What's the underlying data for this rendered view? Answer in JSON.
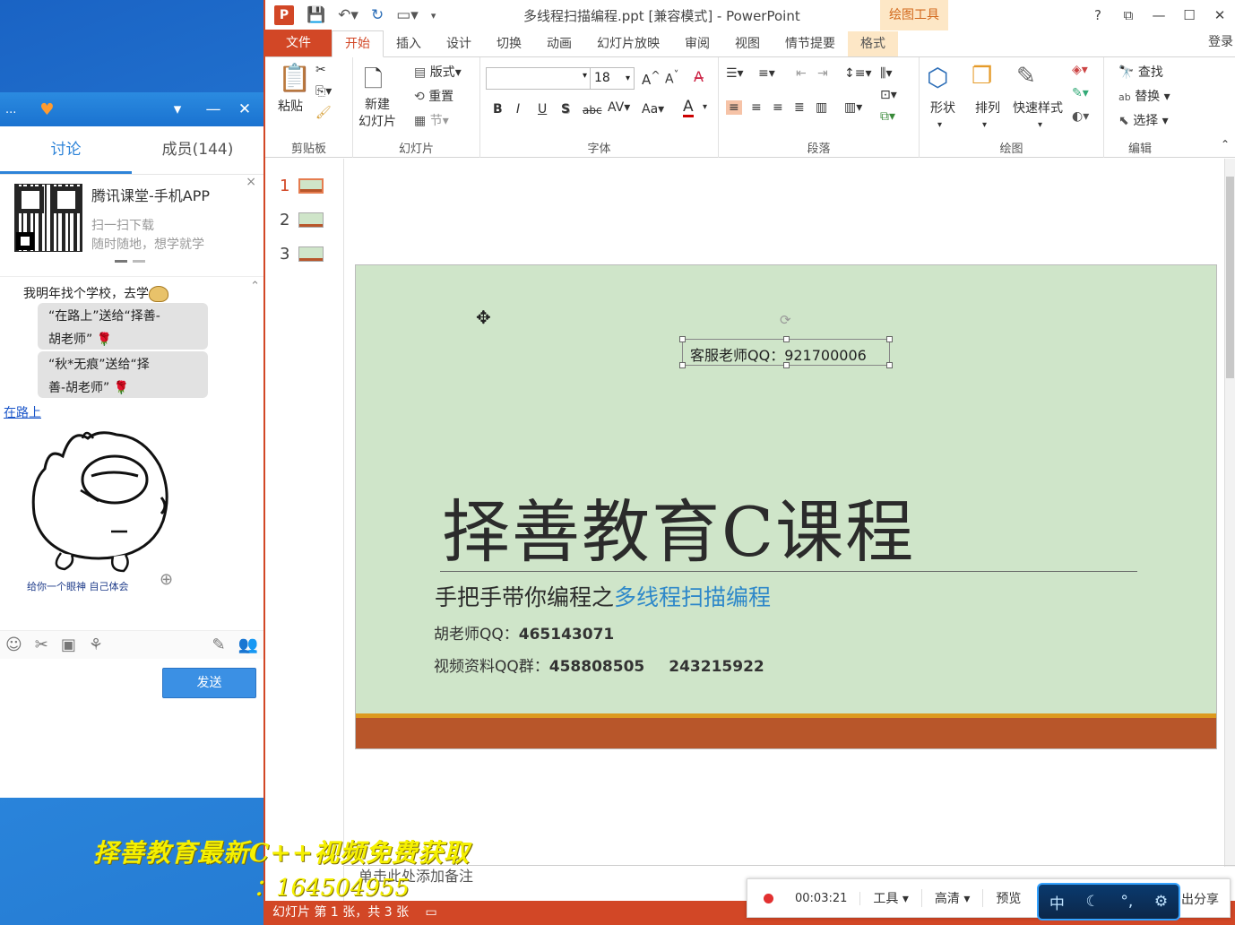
{
  "chat": {
    "title_menu": "...",
    "tabs": [
      "讨论",
      "成员(144)"
    ],
    "ad": {
      "title": "腾讯课堂-手机APP",
      "line1": "扫一扫下载",
      "line2": "随时随地，想学就学",
      "close": "×"
    },
    "messages": {
      "top": "我明年找个学校，去学",
      "gift1_line1": "“在路上”送给“择善-",
      "gift1_line2": "胡老师”",
      "gift2_line1": "“秋*无痕”送给“择",
      "gift2_line2": "善-胡老师”",
      "sender": "在路上",
      "sticker_caption": "给你一个眼神  自己体会"
    },
    "send_label": "发送"
  },
  "ppt": {
    "window_title": "多线程扫描编程.ppt [兼容模式] - PowerPoint",
    "drawing_tools": "绘图工具",
    "login": "登录",
    "window_controls": [
      "?",
      "⧉",
      "—",
      "☐",
      "✕"
    ],
    "menus": [
      "文件",
      "开始",
      "插入",
      "设计",
      "切换",
      "动画",
      "幻灯片放映",
      "审阅",
      "视图",
      "情节提要",
      "格式"
    ],
    "ribbon": {
      "paste": "粘贴",
      "new_slide": "新建\n幻灯片",
      "layout": "版式",
      "reset": "重置",
      "section": "节",
      "font_size": "18",
      "shapes": "形状",
      "arrange": "排列",
      "quick_styles": "快速样式",
      "find": "查找",
      "replace": "替换",
      "select": "选择",
      "groups": [
        "剪贴板",
        "幻灯片",
        "字体",
        "段落",
        "绘图",
        "编辑"
      ]
    },
    "thumbnails": [
      "1",
      "2",
      "3"
    ],
    "slide": {
      "textbox": "客服老师QQ：921700006",
      "title": "择善教育C课程",
      "subtitle_prefix": "手把手带你编程之",
      "subtitle_highlight": "多线程扫描编程",
      "line1_label": "胡老师QQ：",
      "line1_value": "465143071",
      "line2_label": "视频资料QQ群：",
      "line2_value1": "458808505",
      "line2_value2": "243215922"
    },
    "notes_placeholder": "单击此处添加备注",
    "status": "幻灯片 第 1 张，共 3 张"
  },
  "recorder": {
    "time": "00:03:21",
    "tools": "工具",
    "quality": "高清",
    "preview": "预览",
    "share": "出分享"
  },
  "ime": {
    "lang": "中"
  },
  "watermark": {
    "line1": "择善教育最新C++视频免费获取",
    "line2": "：164504955"
  },
  "colors": {
    "ppt_accent": "#d24726",
    "slide_bg": "#cfe5c9",
    "highlight_text": "#2e88c9",
    "chat_accent": "#2d83d8",
    "watermark": "#f5f000"
  }
}
